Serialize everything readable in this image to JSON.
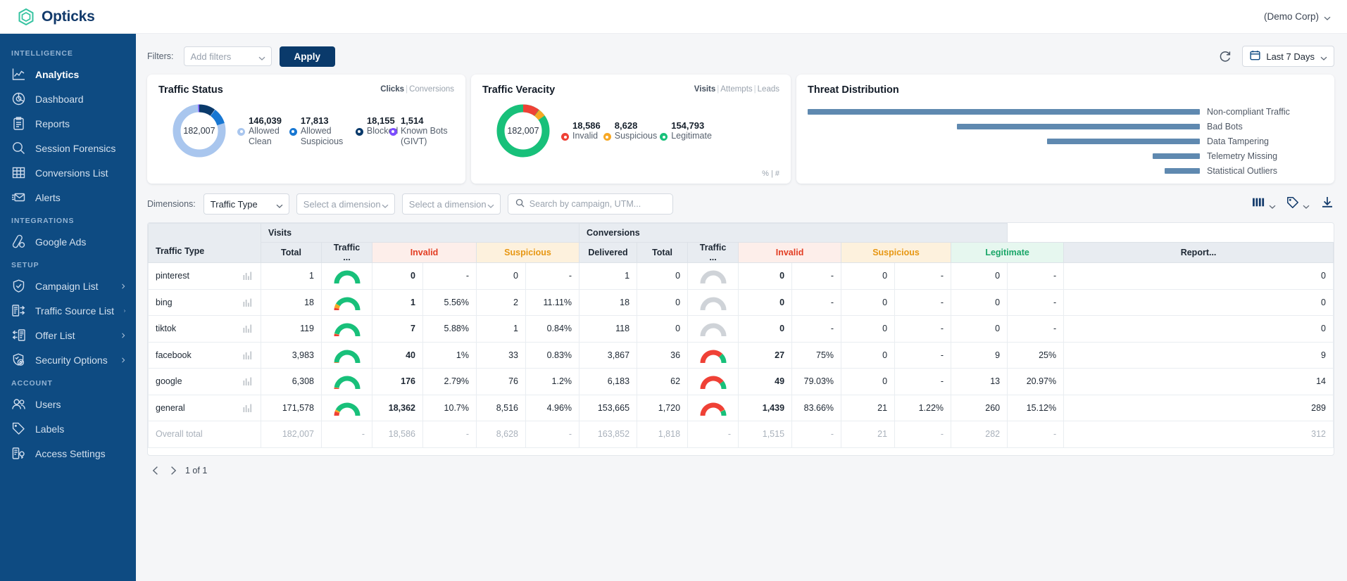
{
  "topbar": {
    "brand": "Opticks",
    "brand_icon": "hexagon-logo-icon",
    "account": "(Demo Corp)",
    "account_caret": "chevron-down-icon"
  },
  "sidebar": {
    "groups": [
      {
        "label": "INTELLIGENCE",
        "items": [
          {
            "label": "Analytics",
            "icon": "line-chart-icon",
            "active": true,
            "expandable": false
          },
          {
            "label": "Dashboard",
            "icon": "pie-chart-icon",
            "active": false,
            "expandable": false
          },
          {
            "label": "Reports",
            "icon": "clipboard-icon",
            "active": false,
            "expandable": false
          },
          {
            "label": "Session Forensics",
            "icon": "magnifier-icon",
            "active": false,
            "expandable": false
          },
          {
            "label": "Conversions List",
            "icon": "grid-table-icon",
            "active": false,
            "expandable": false
          },
          {
            "label": "Alerts",
            "icon": "envelope-alert-icon",
            "active": false,
            "expandable": false
          }
        ]
      },
      {
        "label": "INTEGRATIONS",
        "items": [
          {
            "label": "Google Ads",
            "icon": "google-ads-icon",
            "active": false,
            "expandable": false
          }
        ]
      },
      {
        "label": "SETUP",
        "items": [
          {
            "label": "Campaign List",
            "icon": "shield-check-icon",
            "active": false,
            "expandable": true
          },
          {
            "label": "Traffic Source List",
            "icon": "document-arrows-icon",
            "active": false,
            "expandable": true
          },
          {
            "label": "Offer List",
            "icon": "arrows-document-icon",
            "active": false,
            "expandable": true
          },
          {
            "label": "Security Options",
            "icon": "shield-lock-icon",
            "active": false,
            "expandable": true
          }
        ]
      },
      {
        "label": "ACCOUNT",
        "items": [
          {
            "label": "Users",
            "icon": "users-icon",
            "active": false,
            "expandable": false
          },
          {
            "label": "Labels",
            "icon": "tag-icon",
            "active": false,
            "expandable": false
          },
          {
            "label": "Access Settings",
            "icon": "access-key-icon",
            "active": false,
            "expandable": false
          }
        ]
      }
    ]
  },
  "filterbar": {
    "label": "Filters:",
    "add_filters_placeholder": "Add filters",
    "apply_label": "Apply",
    "refresh_icon": "refresh-icon",
    "calendar_icon": "calendar-icon",
    "date_range": "Last 7 Days",
    "date_caret": "chevron-down-icon"
  },
  "cards": {
    "traffic_status": {
      "title": "Traffic Status",
      "unit_active": "Clicks",
      "unit_inactive": "Conversions",
      "total": "182,007",
      "legend": [
        {
          "value": "146,039",
          "label": "Allowed Clean",
          "color": "#a9c6ee"
        },
        {
          "value": "17,813",
          "label": "Allowed Suspicious",
          "color": "#1877d2"
        },
        {
          "value": "18,155",
          "label": "Blocked",
          "color": "#0a3a6b"
        },
        {
          "value": "1,514",
          "label": "Known Bots (GIVT)",
          "color": "#7c4dff"
        }
      ]
    },
    "traffic_veracity": {
      "title": "Traffic Veracity",
      "unit_active": "Visits",
      "unit_inactive_1": "Attempts",
      "unit_inactive_2": "Leads",
      "footer": "% | #",
      "total": "182,007",
      "legend": [
        {
          "value": "18,586",
          "label": "Invalid",
          "color": "#ef4136"
        },
        {
          "value": "8,628",
          "label": "Suspicious",
          "color": "#f7a824"
        },
        {
          "value": "154,793",
          "label": "Legitimate",
          "color": "#18c07a"
        }
      ]
    },
    "threat_distribution": {
      "title": "Threat Distribution",
      "bar_color": "#5f89b0",
      "items": [
        {
          "label": "Non-compliant Traffic",
          "width_pct": 100
        },
        {
          "label": "Bad Bots",
          "width_pct": 62
        },
        {
          "label": "Data Tampering",
          "width_pct": 39
        },
        {
          "label": "Telemetry Missing",
          "width_pct": 12
        },
        {
          "label": "Statistical Outliers",
          "width_pct": 9
        }
      ]
    }
  },
  "dimensions_bar": {
    "label": "Dimensions:",
    "dim1": "Traffic Type",
    "dim2_placeholder": "Select a dimension",
    "dim3_placeholder": "Select a dimension",
    "search_placeholder": "Search by campaign, UTM...",
    "columns_icon": "columns-icon",
    "label_icon": "tag-icon",
    "download_icon": "download-icon"
  },
  "table": {
    "row_header": "Traffic Type",
    "groups": [
      {
        "label": "Visits",
        "span": 6
      },
      {
        "label": "Conversions",
        "span": 8
      }
    ],
    "columns": [
      {
        "label": "Total",
        "tone": "plain"
      },
      {
        "label": "Traffic ...",
        "tone": "plain"
      },
      {
        "label": "Invalid",
        "tone": "invalid",
        "span": 2
      },
      {
        "label": "Suspicious",
        "tone": "susp",
        "span": 2
      },
      {
        "label": "Delivered",
        "tone": "plain"
      },
      {
        "label": "Total",
        "tone": "plain"
      },
      {
        "label": "Traffic ...",
        "tone": "plain"
      },
      {
        "label": "Invalid",
        "tone": "invalid",
        "span": 2
      },
      {
        "label": "Suspicious",
        "tone": "susp",
        "span": 2
      },
      {
        "label": "Legitimate",
        "tone": "legit",
        "span": 2
      },
      {
        "label": "Report...",
        "tone": "plain"
      }
    ],
    "rows": [
      {
        "name": "pinterest",
        "v_total": "1",
        "v_gauge": {
          "invalid": 0,
          "susp": 0,
          "legit": 100,
          "empty": false
        },
        "v_invalid": "0",
        "v_invalid_pct": "-",
        "v_susp": "0",
        "v_susp_pct": "-",
        "v_delivered": "1",
        "c_total": "0",
        "c_gauge": {
          "invalid": 0,
          "susp": 0,
          "legit": 0,
          "empty": true
        },
        "c_invalid": "0",
        "c_invalid_pct": "-",
        "c_susp": "0",
        "c_susp_pct": "-",
        "c_legit": "0",
        "c_legit_pct": "-",
        "report": "0"
      },
      {
        "name": "bing",
        "v_total": "18",
        "v_gauge": {
          "invalid": 6,
          "susp": 11,
          "legit": 83,
          "empty": false
        },
        "v_invalid": "1",
        "v_invalid_pct": "5.56%",
        "v_susp": "2",
        "v_susp_pct": "11.11%",
        "v_delivered": "18",
        "c_total": "0",
        "c_gauge": {
          "invalid": 0,
          "susp": 0,
          "legit": 0,
          "empty": true
        },
        "c_invalid": "0",
        "c_invalid_pct": "-",
        "c_susp": "0",
        "c_susp_pct": "-",
        "c_legit": "0",
        "c_legit_pct": "-",
        "report": "0"
      },
      {
        "name": "tiktok",
        "v_total": "119",
        "v_gauge": {
          "invalid": 6,
          "susp": 1,
          "legit": 93,
          "empty": false
        },
        "v_invalid": "7",
        "v_invalid_pct": "5.88%",
        "v_susp": "1",
        "v_susp_pct": "0.84%",
        "v_delivered": "118",
        "c_total": "0",
        "c_gauge": {
          "invalid": 0,
          "susp": 0,
          "legit": 0,
          "empty": true
        },
        "c_invalid": "0",
        "c_invalid_pct": "-",
        "c_susp": "0",
        "c_susp_pct": "-",
        "c_legit": "0",
        "c_legit_pct": "-",
        "report": "0"
      },
      {
        "name": "facebook",
        "v_total": "3,983",
        "v_gauge": {
          "invalid": 1,
          "susp": 1,
          "legit": 98,
          "empty": false
        },
        "v_invalid": "40",
        "v_invalid_pct": "1%",
        "v_susp": "33",
        "v_susp_pct": "0.83%",
        "v_delivered": "3,867",
        "c_total": "36",
        "c_gauge": {
          "invalid": 75,
          "susp": 0,
          "legit": 25,
          "empty": false
        },
        "c_invalid": "27",
        "c_invalid_pct": "75%",
        "c_susp": "0",
        "c_susp_pct": "-",
        "c_legit": "9",
        "c_legit_pct": "25%",
        "report": "9"
      },
      {
        "name": "google",
        "v_total": "6,308",
        "v_gauge": {
          "invalid": 3,
          "susp": 1,
          "legit": 96,
          "empty": false
        },
        "v_invalid": "176",
        "v_invalid_pct": "2.79%",
        "v_susp": "76",
        "v_susp_pct": "1.2%",
        "v_delivered": "6,183",
        "c_total": "62",
        "c_gauge": {
          "invalid": 79,
          "susp": 0,
          "legit": 21,
          "empty": false
        },
        "c_invalid": "49",
        "c_invalid_pct": "79.03%",
        "c_susp": "0",
        "c_susp_pct": "-",
        "c_legit": "13",
        "c_legit_pct": "20.97%",
        "report": "14"
      },
      {
        "name": "general",
        "v_total": "171,578",
        "v_gauge": {
          "invalid": 11,
          "susp": 5,
          "legit": 84,
          "empty": false
        },
        "v_invalid": "18,362",
        "v_invalid_pct": "10.7%",
        "v_susp": "8,516",
        "v_susp_pct": "4.96%",
        "v_delivered": "153,665",
        "c_total": "1,720",
        "c_gauge": {
          "invalid": 84,
          "susp": 1,
          "legit": 15,
          "empty": false
        },
        "c_invalid": "1,439",
        "c_invalid_pct": "83.66%",
        "c_susp": "21",
        "c_susp_pct": "1.22%",
        "c_legit": "260",
        "c_legit_pct": "15.12%",
        "report": "289"
      }
    ],
    "overall": {
      "name": "Overall total",
      "v_total": "182,007",
      "v_gauge": "-",
      "v_invalid": "18,586",
      "v_invalid_pct": "-",
      "v_susp": "8,628",
      "v_susp_pct": "-",
      "v_delivered": "163,852",
      "c_total": "1,818",
      "c_gauge": "-",
      "c_invalid": "1,515",
      "c_invalid_pct": "-",
      "c_susp": "21",
      "c_susp_pct": "-",
      "c_legit": "282",
      "c_legit_pct": "-",
      "report": "312"
    }
  },
  "pagination": {
    "prev_icon": "chevron-left-icon",
    "next_icon": "chevron-right-icon",
    "text": "1 of 1"
  }
}
